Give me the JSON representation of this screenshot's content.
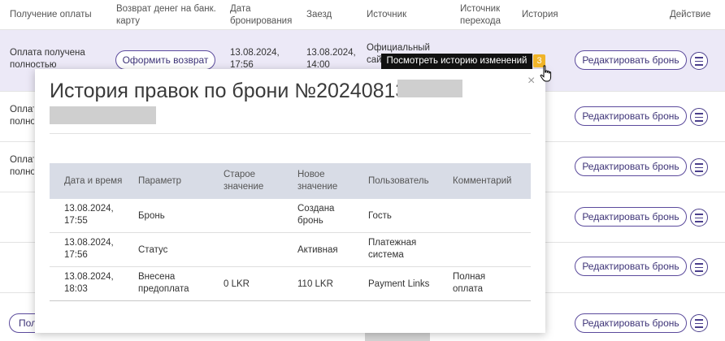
{
  "table": {
    "headers": {
      "payment": "Получение оплаты",
      "refund": "Возврат денег на банк. карту",
      "booking_date": "Дата бронирования",
      "checkin": "Заезд",
      "source": "Источник",
      "ref_source": "Источник перехода",
      "history": "История",
      "action": "Действие"
    },
    "row1": {
      "payment": "Оплата получена полностью",
      "refund_button": "Оформить возврат",
      "booking_date": "13.08.2024, 17:56",
      "checkin": "13.08.2024, 14:00",
      "source": "Официальный сайт"
    },
    "row_partial": [
      "Оплат полно",
      "Оплат полно"
    ],
    "row_bottom_partial": "Пол",
    "edit_button": "Редактировать бронь"
  },
  "tooltip": {
    "text": "Посмотреть историю изменений",
    "count": "3"
  },
  "modal": {
    "title": "История правок по брони №20240813-",
    "close": "×",
    "columns": {
      "datetime": "Дата и время",
      "param": "Параметр",
      "old": "Старое значение",
      "new": "Новое значение",
      "user": "Пользователь",
      "comment": "Комментарий"
    },
    "rows": [
      {
        "datetime": "13.08.2024, 17:55",
        "param": "Бронь",
        "old": "",
        "new": "Создана бронь",
        "user": "Гость",
        "comment": ""
      },
      {
        "datetime": "13.08.2024, 17:56",
        "param": "Статус",
        "old": "",
        "new": "Активная",
        "user": "Платежная система",
        "comment": ""
      },
      {
        "datetime": "13.08.2024, 18:03",
        "param": "Внесена предоплата",
        "old": "0 LKR",
        "new": "110 LKR",
        "user": "Payment Links",
        "comment": "Полная оплата"
      }
    ]
  }
}
